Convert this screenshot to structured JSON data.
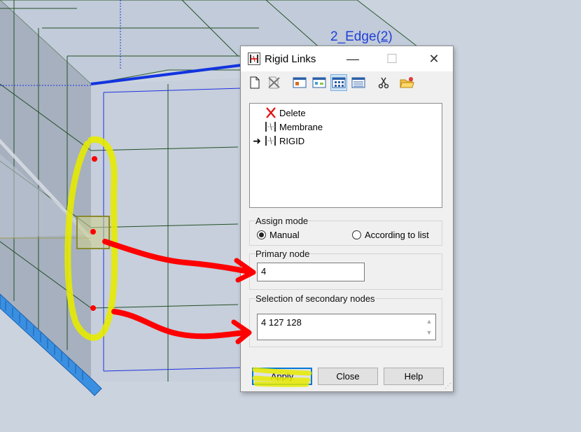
{
  "viewport": {
    "edge_label_name": "2_Edge",
    "edge_label_open": "(",
    "edge_label_number": "2",
    "edge_label_close": ")"
  },
  "dialog": {
    "title": "Rigid Links",
    "window_buttons": {
      "minimize": "—",
      "maximize": "☐",
      "close": "✕"
    },
    "toolbar": {
      "icons": [
        "new-document-icon",
        "delete-icon",
        "view-icon-1",
        "view-icon-2",
        "table-view-icon",
        "list-view-icon",
        "cut-icon",
        "open-folder-icon"
      ]
    },
    "list": {
      "items": [
        {
          "label": "Delete",
          "icon": "red-x-icon",
          "selected": false
        },
        {
          "label": "Membrane",
          "icon": "rigid-link-icon",
          "selected": false
        },
        {
          "label": "RIGID",
          "icon": "rigid-link-icon",
          "selected": true
        }
      ],
      "current_marker": "➜"
    },
    "assign_mode": {
      "label": "Assign mode",
      "options": [
        {
          "label": "Manual",
          "checked": true
        },
        {
          "label": "According to list",
          "checked": false
        }
      ]
    },
    "primary_node": {
      "label": "Primary node",
      "value": "4"
    },
    "secondary_nodes": {
      "label": "Selection of secondary nodes",
      "value": "4 127 128"
    },
    "buttons": {
      "apply": "Apply",
      "close": "Close",
      "help": "Help"
    }
  },
  "colors": {
    "annotation_red": "#ff0000",
    "annotation_yellow": "#e6ea00",
    "edge_label": "#1f3fd8",
    "selection_blue": "#1234e0"
  }
}
